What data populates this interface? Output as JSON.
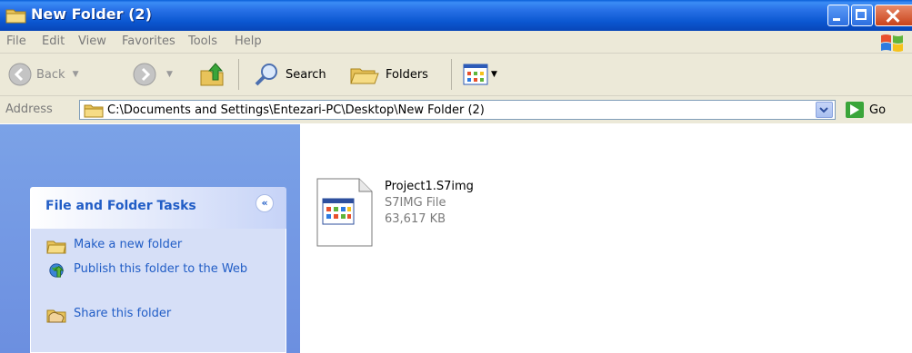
{
  "window": {
    "title": "New Folder (2)"
  },
  "menu": {
    "items": [
      "File",
      "Edit",
      "View",
      "Favorites",
      "Tools",
      "Help"
    ]
  },
  "toolbar": {
    "back_label": "Back",
    "search_label": "Search",
    "folders_label": "Folders"
  },
  "address": {
    "label": "Address",
    "value": "C:\\Documents and Settings\\Entezari-PC\\Desktop\\New Folder (2)",
    "go_label": "Go"
  },
  "tasks": {
    "title": "File and Folder Tasks",
    "links": [
      "Make a new folder",
      "Publish this folder to the Web",
      "Share this folder"
    ]
  },
  "files": [
    {
      "name": "Project1.S7img",
      "type": "S7IMG File",
      "size": "63,617 KB"
    }
  ],
  "colors": {
    "titlebar": "#0b57d1",
    "chrome": "#ece9d8",
    "tasks_pane": "#7ba2e7",
    "link": "#215dc6"
  }
}
